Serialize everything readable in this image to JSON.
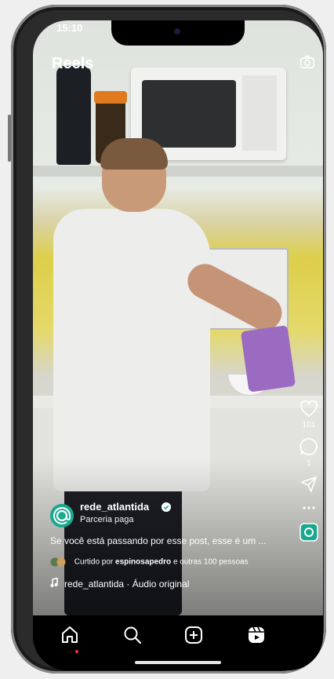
{
  "status_bar": {
    "time": "15:10"
  },
  "header": {
    "title": "Reels"
  },
  "actions": {
    "likes_count": "101",
    "comments_count": "1"
  },
  "post": {
    "username": "rede_atlantida",
    "partnership": "Parceria paga",
    "caption": "Se você está passando por esse post, esse é um ...",
    "liked_prefix": "Curtido por ",
    "liked_user": "espinosapedro",
    "liked_suffix": " e outras 100 pessoas",
    "audio": "rede_atlantida · Áudio original"
  },
  "colors": {
    "accent_teal": "#1aa88e",
    "notification_dot": "#ff3040"
  },
  "icons": [
    "camera-icon",
    "heart-icon",
    "comment-icon",
    "share-icon",
    "more-icon",
    "music-note-icon",
    "home-icon",
    "search-icon",
    "create-icon",
    "reels-icon"
  ]
}
